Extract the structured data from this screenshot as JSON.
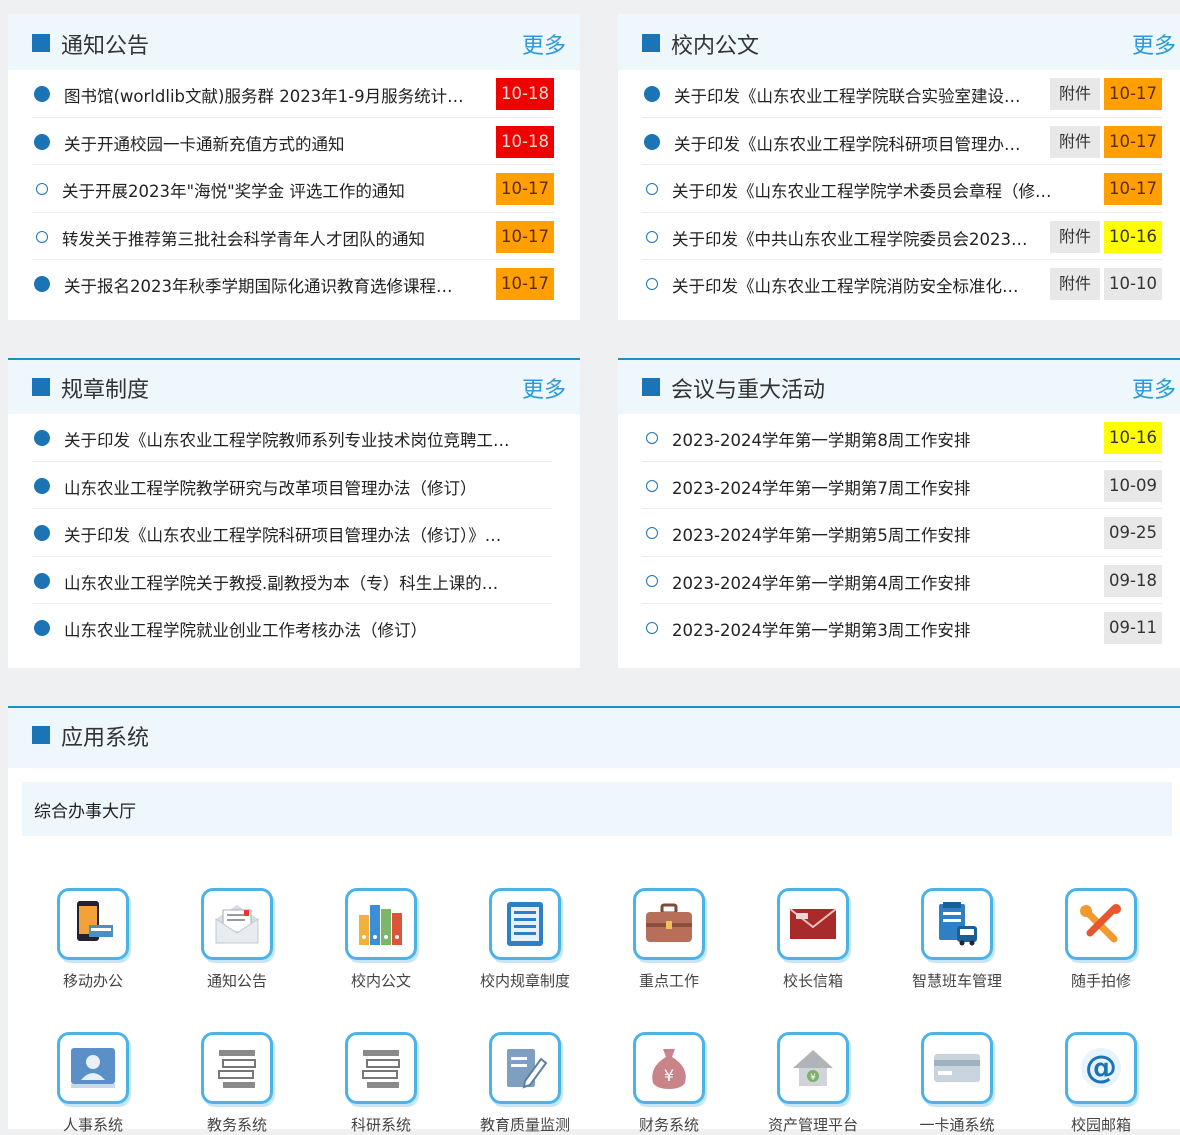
{
  "panels": [
    {
      "title": "通知公告",
      "more": "更多",
      "items": [
        {
          "text": "图书馆(worldlib文献)服务群 2023年1-9月服务统计…",
          "date": "10-18",
          "date_color": "red",
          "dot": "filled"
        },
        {
          "text": "关于开通校园一卡通新充值方式的通知",
          "date": "10-18",
          "date_color": "red",
          "dot": "filled"
        },
        {
          "text": "关于开展2023年\"海悦\"奖学金 评选工作的通知",
          "date": "10-17",
          "date_color": "orange",
          "dot": "hollow"
        },
        {
          "text": "转发关于推荐第三批社会科学青年人才团队的通知",
          "date": "10-17",
          "date_color": "orange",
          "dot": "hollow"
        },
        {
          "text": "关于报名2023年秋季学期国际化通识教育选修课程…",
          "date": "10-17",
          "date_color": "orange",
          "dot": "filled"
        }
      ]
    },
    {
      "title": "校内公文",
      "more": "更多",
      "items": [
        {
          "text": "关于印发《山东农业工程学院联合实验室建设…",
          "attachment": "附件",
          "date": "10-17",
          "date_color": "orange",
          "dot": "filled"
        },
        {
          "text": "关于印发《山东农业工程学院科研项目管理办…",
          "attachment": "附件",
          "date": "10-17",
          "date_color": "orange",
          "dot": "filled"
        },
        {
          "text": "关于印发《山东农业工程学院学术委员会章程（修…",
          "date": "10-17",
          "date_color": "orange",
          "dot": "hollow"
        },
        {
          "text": "关于印发《中共山东农业工程学院委员会2023…",
          "attachment": "附件",
          "date": "10-16",
          "date_color": "yellow",
          "dot": "hollow"
        },
        {
          "text": "关于印发《山东农业工程学院消防安全标准化…",
          "attachment": "附件",
          "date": "10-10",
          "date_color": "gray",
          "dot": "hollow"
        }
      ]
    },
    {
      "title": "规章制度",
      "more": "更多",
      "items": [
        {
          "text": "关于印发《山东农业工程学院教师系列专业技术岗位竞聘工…",
          "dot": "filled"
        },
        {
          "text": "山东农业工程学院教学研究与改革项目管理办法（修订）",
          "dot": "filled"
        },
        {
          "text": "关于印发《山东农业工程学院科研项目管理办法（修订）》…",
          "dot": "filled"
        },
        {
          "text": "山东农业工程学院关于教授.副教授为本（专）科生上课的…",
          "dot": "filled"
        },
        {
          "text": "山东农业工程学院就业创业工作考核办法（修订）",
          "dot": "filled"
        }
      ]
    },
    {
      "title": "会议与重大活动",
      "more": "更多",
      "items": [
        {
          "text": "2023-2024学年第一学期第8周工作安排",
          "date": "10-16",
          "date_color": "yellow",
          "dot": "hollow"
        },
        {
          "text": "2023-2024学年第一学期第7周工作安排",
          "date": "10-09",
          "date_color": "gray",
          "dot": "hollow"
        },
        {
          "text": "2023-2024学年第一学期第5周工作安排",
          "date": "09-25",
          "date_color": "gray",
          "dot": "hollow"
        },
        {
          "text": "2023-2024学年第一学期第4周工作安排",
          "date": "09-18",
          "date_color": "gray",
          "dot": "hollow"
        },
        {
          "text": "2023-2024学年第一学期第3周工作安排",
          "date": "09-11",
          "date_color": "gray",
          "dot": "hollow"
        }
      ]
    }
  ],
  "apps": {
    "title": "应用系统",
    "subtitle": "综合办事大厅",
    "items": [
      {
        "label": "移动办公",
        "icon": "mobile-phone-icon"
      },
      {
        "label": "通知公告",
        "icon": "envelope-letter-icon"
      },
      {
        "label": "校内公文",
        "icon": "binders-icon"
      },
      {
        "label": "校内规章制度",
        "icon": "document-list-icon"
      },
      {
        "label": "重点工作",
        "icon": "briefcase-icon"
      },
      {
        "label": "校长信箱",
        "icon": "mail-envelope-icon"
      },
      {
        "label": "智慧班车管理",
        "icon": "bus-icon"
      },
      {
        "label": "随手拍修",
        "icon": "repair-tools-icon"
      },
      {
        "label": "人事系统",
        "icon": "person-card-icon"
      },
      {
        "label": "教务系统",
        "icon": "books-stack-icon"
      },
      {
        "label": "科研系统",
        "icon": "books-stack-icon"
      },
      {
        "label": "教育质量监测",
        "icon": "document-pen-icon"
      },
      {
        "label": "财务系统",
        "icon": "money-bag-icon"
      },
      {
        "label": "资产管理平台",
        "icon": "house-icon"
      },
      {
        "label": "一卡通系统",
        "icon": "card-icon"
      },
      {
        "label": "校园邮箱",
        "icon": "at-sign-icon"
      }
    ]
  },
  "colors": {
    "accent": "#1b74b5",
    "more": "#2d98d9",
    "red": "#f00000",
    "orange": "#ffa000",
    "yellow": "#ffff00",
    "gray": "#e8e8e8"
  }
}
